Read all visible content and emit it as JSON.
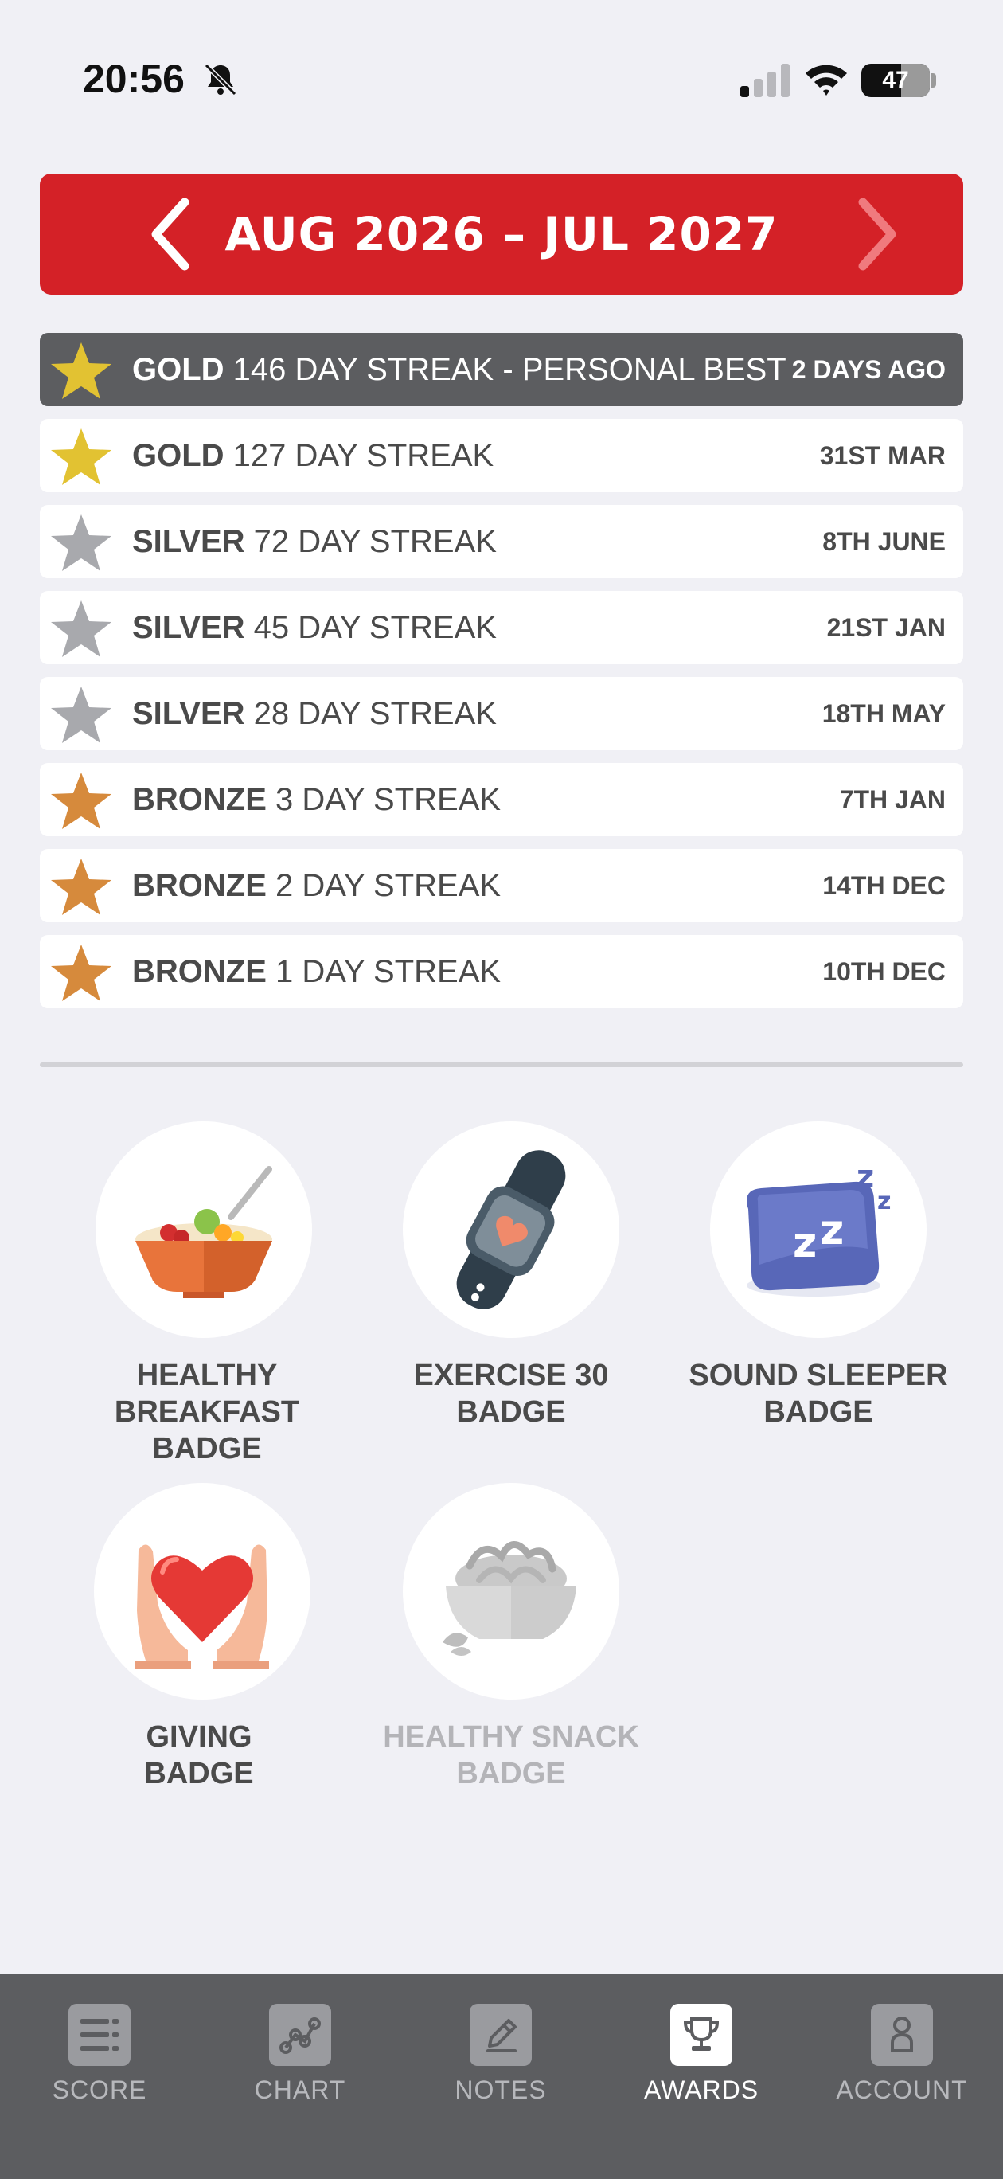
{
  "status_bar": {
    "time": "20:56",
    "battery": "47"
  },
  "header": {
    "period": "AUG 2026 – JUL 2027"
  },
  "streaks": [
    {
      "tier": "GOLD",
      "text": "146 DAY STREAK - PERSONAL BEST",
      "date": "2 DAYS AGO",
      "color": "#e2c232",
      "highlight": true
    },
    {
      "tier": "GOLD",
      "text": "127 DAY STREAK",
      "date": "31ST MAR",
      "color": "#e2c232"
    },
    {
      "tier": "SILVER",
      "text": "72 DAY STREAK",
      "date": "8TH JUNE",
      "color": "#a8a9ad"
    },
    {
      "tier": "SILVER",
      "text": "45 DAY STREAK",
      "date": "21ST JAN",
      "color": "#a8a9ad"
    },
    {
      "tier": "SILVER",
      "text": "28 DAY STREAK",
      "date": "18TH MAY",
      "color": "#a8a9ad"
    },
    {
      "tier": "BRONZE",
      "text": "3 DAY STREAK",
      "date": "7TH JAN",
      "color": "#d68a3c"
    },
    {
      "tier": "BRONZE",
      "text": "2 DAY STREAK",
      "date": "14TH DEC",
      "color": "#d68a3c"
    },
    {
      "tier": "BRONZE",
      "text": "1 DAY STREAK",
      "date": "10TH DEC",
      "color": "#d68a3c"
    }
  ],
  "badges": [
    {
      "line1": "HEALTHY",
      "line2": "BREAKFAST BADGE",
      "icon": "breakfast-bowl-icon"
    },
    {
      "line1": "EXERCISE 30",
      "line2": "BADGE",
      "icon": "smartwatch-icon"
    },
    {
      "line1": "SOUND SLEEPER",
      "line2": "BADGE",
      "icon": "sleep-pillow-icon"
    },
    {
      "line1": "GIVING",
      "line2": "BADGE",
      "icon": "heart-hands-icon"
    },
    {
      "line1": "HEALTHY SNACK",
      "line2": "BADGE",
      "icon": "snack-bowl-icon",
      "locked": true
    }
  ],
  "tabs": [
    {
      "label": "SCORE",
      "icon": "list-icon"
    },
    {
      "label": "CHART",
      "icon": "chart-icon"
    },
    {
      "label": "NOTES",
      "icon": "pencil-icon"
    },
    {
      "label": "AWARDS",
      "icon": "trophy-icon",
      "active": true
    },
    {
      "label": "ACCOUNT",
      "icon": "person-icon"
    }
  ],
  "colors": {
    "header_red": "#d42127",
    "tab_bar": "#5c5d60",
    "background": "#f0f0f5"
  }
}
